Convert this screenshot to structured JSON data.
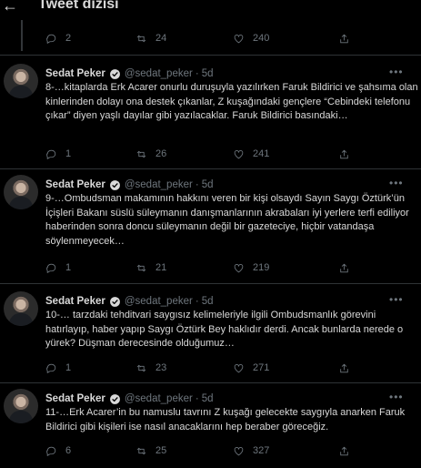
{
  "header": {
    "back_icon": "back-arrow-icon",
    "title": "Tweet dizisi"
  },
  "first_actions": {
    "reply": "2",
    "retweet": "24",
    "like": "240"
  },
  "tweets": [
    {
      "name": "Sedat Peker",
      "handle": "@sedat_peker",
      "dot": "·",
      "time": "5d",
      "text": "8-…kitaplarda Erk Acarer onurlu duruşuyla yazılırken Faruk Bildirici ve şahsıma olan kinlerinden dolayı ona destek çıkanlar, Z kuşağındaki gençlere “Cebindeki telefonu çıkar” diyen yaşlı dayılar gibi yazılacaklar. Faruk Bildirici basındaki…",
      "reply": "1",
      "retweet": "26",
      "like": "241"
    },
    {
      "name": "Sedat Peker",
      "handle": "@sedat_peker",
      "dot": "·",
      "time": "5d",
      "text": "9-…Ombudsman makamının hakkını veren bir kişi olsaydı Sayın Saygı Öztürk’ün İçişleri Bakanı süslü süleymanın danışmanlarının akrabaları iyi yerlere terfi ediliyor haberinden sonra doncu süleymanın değil bir gazeteciye, hiçbir vatandaşa söylenmeyecek…",
      "reply": "1",
      "retweet": "21",
      "like": "219"
    },
    {
      "name": "Sedat Peker",
      "handle": "@sedat_peker",
      "dot": "·",
      "time": "5d",
      "text": "10-… tarzdaki tehditvari saygısız kelimeleriyle ilgili Ombudsmanlık görevini hatırlayıp, haber yapıp Saygı Öztürk Bey haklıdır derdi. Ancak bunlarda nerede o yürek? Düşman derecesinde olduğumuz…",
      "reply": "1",
      "retweet": "23",
      "like": "271"
    },
    {
      "name": "Sedat Peker",
      "handle": "@sedat_peker",
      "dot": "·",
      "time": "5d",
      "text": "11-…Erk Acarer’in bu namuslu tavrını Z kuşağı gelecekte saygıyla anarken Faruk Bildirici gibi kişileri ise nasıl anacaklarını  hep beraber göreceğiz.",
      "reply": "6",
      "retweet": "25",
      "like": "327"
    }
  ],
  "icons": {
    "reply": "reply-icon",
    "retweet": "retweet-icon",
    "like": "heart-icon",
    "share": "share-icon",
    "verified": "verified-badge-icon",
    "more": "more-icon"
  },
  "colors": {
    "background": "#000000",
    "text": "#d9d9d9",
    "muted": "#6e767d",
    "divider": "#2f3336",
    "verified": "#d9d9d9"
  }
}
